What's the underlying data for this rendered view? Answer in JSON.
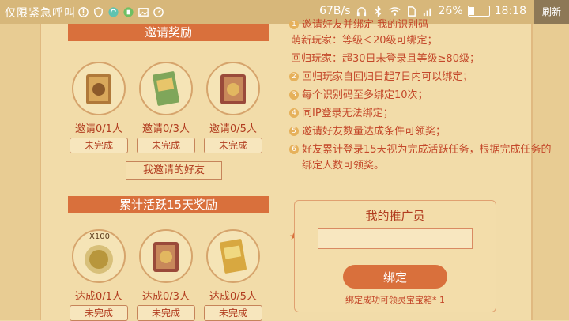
{
  "status_bar": {
    "carrier": "仅限紧急呼叫",
    "speed": "67B/s",
    "battery": "26%",
    "battery_level": 0.26,
    "time": "18:18"
  },
  "refresh_label": "刷新",
  "invite_rewards": {
    "title": "邀请奖励",
    "items": [
      {
        "label": "邀请0/1人",
        "status": "未完成",
        "icon": "chest-icon"
      },
      {
        "label": "邀请0/3人",
        "status": "未完成",
        "icon": "treasure-book-icon"
      },
      {
        "label": "邀请0/5人",
        "status": "未完成",
        "icon": "chest-icon"
      }
    ],
    "friends_button": "我邀请的好友"
  },
  "active_rewards": {
    "title": "累计活跃15天奖励",
    "items": [
      {
        "label": "达成0/1人",
        "status": "未完成",
        "icon": "merit-medal-icon",
        "badge": "X100"
      },
      {
        "label": "达成0/3人",
        "status": "未完成",
        "icon": "chest-icon"
      },
      {
        "label": "达成0/5人",
        "status": "未完成",
        "icon": "treasure-book-icon"
      }
    ]
  },
  "rules": [
    "邀请好友并绑定 我的识别码",
    "萌新玩家：等级＜20级可绑定；",
    "回归玩家：超30日未登录且等级≥80级；",
    "回归玩家自回归日起7日内可以绑定；",
    "每个识别码至多绑定10次；",
    "同IP登录无法绑定；",
    "邀请好友数量达成条件可领奖；",
    "好友累计登录15天视为完成活跃任务，根据完成任务的绑定人数可领奖。"
  ],
  "promoter": {
    "title": "我的推广员",
    "input_placeholder": "",
    "bind_button": "绑定",
    "tip": "绑定成功可领灵宝宝箱* 1"
  }
}
